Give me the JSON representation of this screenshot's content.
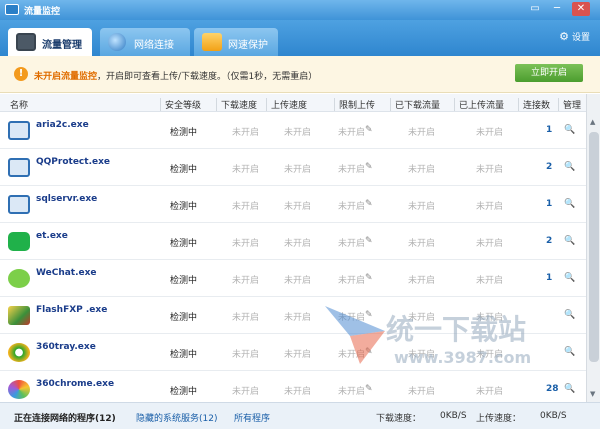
{
  "window": {
    "title": "流量监控"
  },
  "tabs": [
    {
      "label": "流量管理",
      "icon": "monitor-icon"
    },
    {
      "label": "网络连接",
      "icon": "globe-icon"
    },
    {
      "label": "网速保护",
      "icon": "shield-icon"
    }
  ],
  "settings_label": "设置",
  "notice": {
    "highlight": "未开启流量监控",
    "text": "，开启即可查看上传/下载速度。（仅需1秒，无需重启）",
    "button": "立即开启"
  },
  "columns": [
    "名称",
    "安全等级",
    "下载速度",
    "上传速度",
    "限制上传",
    "已下载流量",
    "已上传流量",
    "连接数",
    "管理"
  ],
  "rows": [
    {
      "name": "aria2c.exe",
      "security": "检测中",
      "download": "未开启",
      "upload": "未开启",
      "limit": "未开启",
      "downloaded": "未开启",
      "uploaded": "未开启",
      "connections": "1",
      "icon": "app-window-icon"
    },
    {
      "name": "QQProtect.exe",
      "security": "检测中",
      "download": "未开启",
      "upload": "未开启",
      "limit": "未开启",
      "downloaded": "未开启",
      "uploaded": "未开启",
      "connections": "2",
      "icon": "app-window-icon"
    },
    {
      "name": "sqlservr.exe",
      "security": "检测中",
      "download": "未开启",
      "upload": "未开启",
      "limit": "未开启",
      "downloaded": "未开启",
      "uploaded": "未开启",
      "connections": "1",
      "icon": "app-window-icon"
    },
    {
      "name": "et.exe",
      "security": "检测中",
      "download": "未开启",
      "upload": "未开启",
      "limit": "未开启",
      "downloaded": "未开启",
      "uploaded": "未开启",
      "connections": "2",
      "icon": "spreadsheet-icon"
    },
    {
      "name": "WeChat.exe",
      "security": "检测中",
      "download": "未开启",
      "upload": "未开启",
      "limit": "未开启",
      "downloaded": "未开启",
      "uploaded": "未开启",
      "connections": "1",
      "icon": "wechat-icon"
    },
    {
      "name": "FlashFXP .exe",
      "security": "检测中",
      "download": "未开启",
      "upload": "未开启",
      "limit": "未开启",
      "downloaded": "未开启",
      "uploaded": "未开启",
      "connections": "",
      "icon": "flashfxp-icon"
    },
    {
      "name": "360tray.exe",
      "security": "检测中",
      "download": "未开启",
      "upload": "未开启",
      "limit": "未开启",
      "downloaded": "未开启",
      "uploaded": "未开启",
      "connections": "",
      "icon": "360-icon"
    },
    {
      "name": "360chrome.exe",
      "security": "检测中",
      "download": "未开启",
      "upload": "未开启",
      "limit": "未开启",
      "downloaded": "未开启",
      "uploaded": "未开启",
      "connections": "28",
      "icon": "browser-icon"
    }
  ],
  "status": {
    "active": "正在连接网络的程序(12)",
    "hidden": "隐藏的系统服务(12)",
    "all": "所有程序",
    "download_label": "下载速度：",
    "download_value": "0KB/S",
    "upload_label": "上传速度：",
    "upload_value": "0KB/S"
  },
  "watermark": {
    "text": "统一下载站",
    "url": "www.3987.com"
  }
}
